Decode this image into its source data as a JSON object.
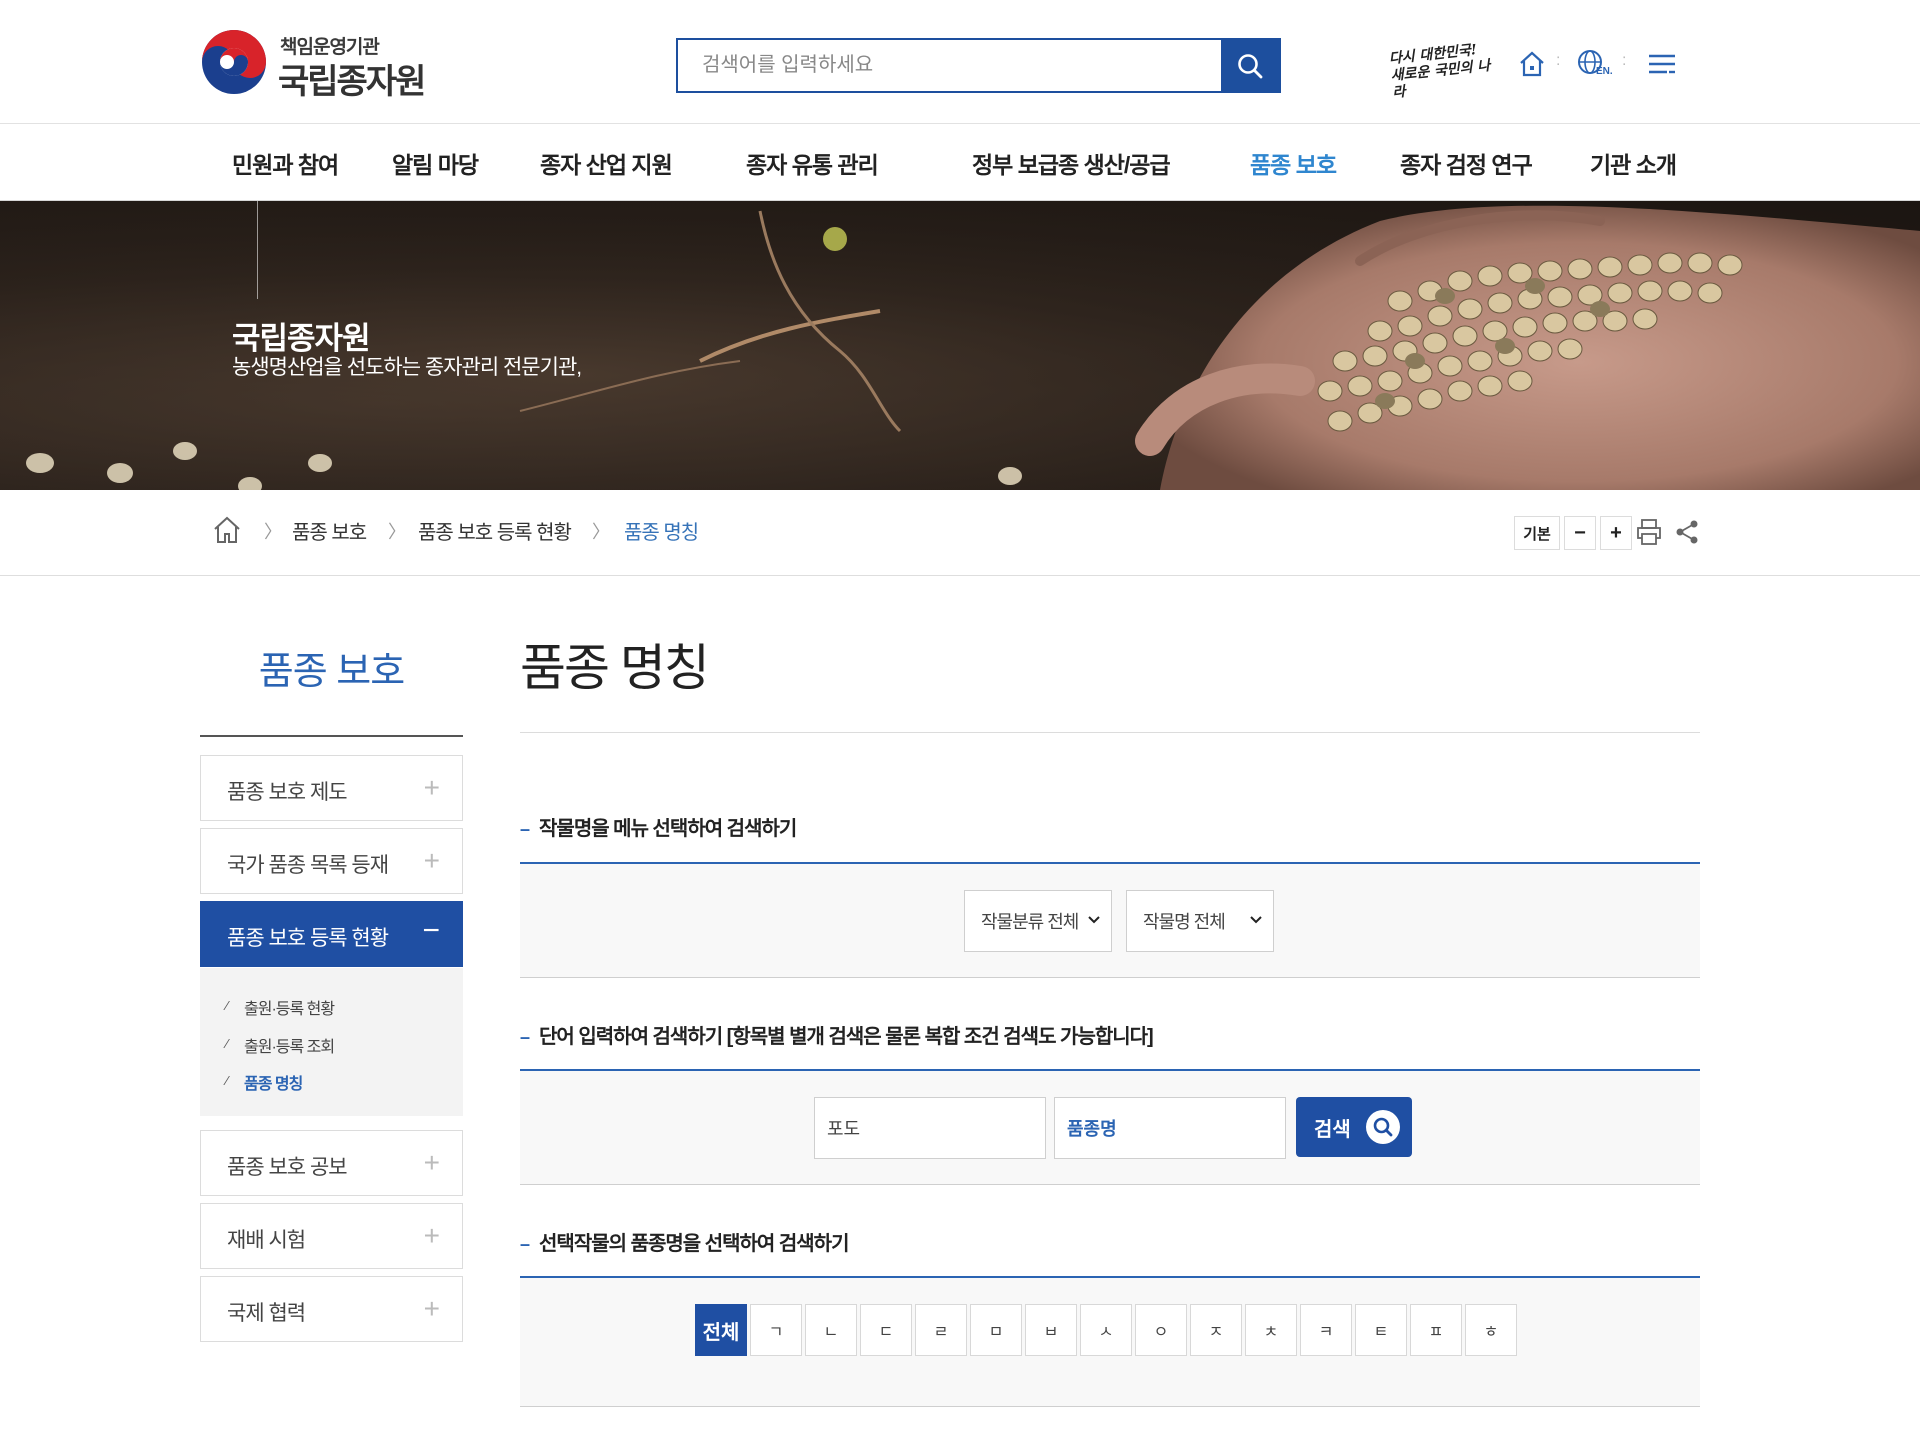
{
  "header": {
    "logo_sub": "책임운영기관",
    "logo_main": "국립종자원",
    "search_placeholder": "검색어를 입력하세요",
    "slogan_line1": "다시 대한민국!",
    "slogan_line2": "새로운 국민의 나라",
    "lang_badge": "EN."
  },
  "gnb": [
    {
      "label": "민원과 참여"
    },
    {
      "label": "알림 마당"
    },
    {
      "label": "종자 산업 지원"
    },
    {
      "label": "종자 유통 관리"
    },
    {
      "label": "정부 보급종 생산/공급"
    },
    {
      "label": "품종 보호"
    },
    {
      "label": "종자 검정 연구"
    },
    {
      "label": "기관 소개"
    }
  ],
  "hero": {
    "title": "국립종자원",
    "desc": "농생명산업을 선도하는 종자관리 전문기관,"
  },
  "breadcrumb": {
    "items": [
      "품종 보호",
      "품종 보호 등록 현황",
      "품종 명칭"
    ],
    "tools": {
      "font_default": "기본",
      "minus": "−",
      "plus": "+"
    }
  },
  "lnb": {
    "title": "품종 보호",
    "items": [
      {
        "label": "품종 보호 제도"
      },
      {
        "label": "국가 품종 목록 등재"
      },
      {
        "label": "품종 보호 등록 현황"
      },
      {
        "label": "품종 보호 공보"
      },
      {
        "label": "재배 시험"
      },
      {
        "label": "국제 협력"
      }
    ],
    "sub_items": [
      {
        "label": "출원·등록 현황"
      },
      {
        "label": "출원·등록 조회"
      },
      {
        "label": "품종 명칭"
      }
    ]
  },
  "content": {
    "page_title": "품종 명칭",
    "sections": [
      {
        "title": "작물명을 메뉴 선택하여 검색하기"
      },
      {
        "title": "단어 입력하여 검색하기 [항목별 별개 검색은 물론 복합 조건 검색도 가능합니다]"
      },
      {
        "title": "선택작물의 품종명을 선택하여 검색하기"
      }
    ],
    "select_category": "작물분류 전체",
    "select_crop": "작물명 전체",
    "word_input": "포도",
    "field_select": "품종명",
    "search_button": "검색",
    "consonants": [
      "전체",
      "ㄱ",
      "ㄴ",
      "ㄷ",
      "ㄹ",
      "ㅁ",
      "ㅂ",
      "ㅅ",
      "ㅇ",
      "ㅈ",
      "ㅊ",
      "ㅋ",
      "ㅌ",
      "ㅍ",
      "ㅎ"
    ]
  },
  "colors": {
    "primary": "#1f4fa3",
    "accent_menu": "#2f86cf",
    "link": "#2b64b3"
  }
}
